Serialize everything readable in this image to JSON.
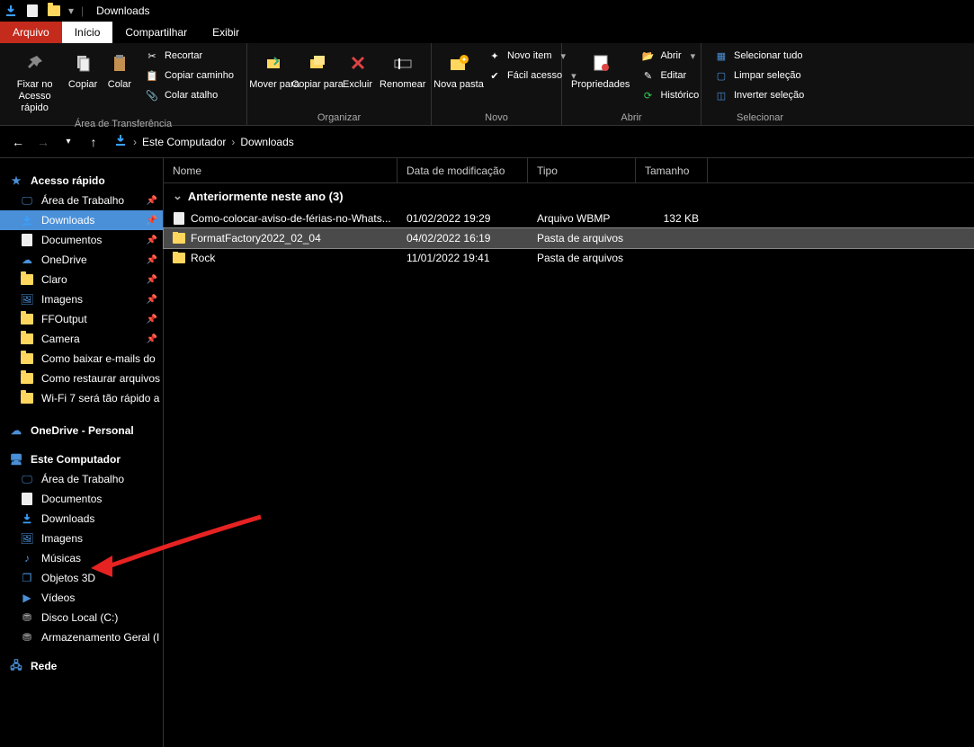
{
  "title_bar": {
    "title": "Downloads"
  },
  "tabs": {
    "arquivo": "Arquivo",
    "inicio": "Início",
    "compartilhar": "Compartilhar",
    "exibir": "Exibir"
  },
  "ribbon": {
    "pin": "Fixar no Acesso rápido",
    "copiar": "Copiar",
    "colar": "Colar",
    "recortar": "Recortar",
    "copiar_caminho": "Copiar caminho",
    "colar_atalho": "Colar atalho",
    "group_area": "Área de Transferência",
    "mover_para": "Mover para",
    "copiar_para": "Copiar para",
    "excluir": "Excluir",
    "renomear": "Renomear",
    "group_organizar": "Organizar",
    "nova_pasta": "Nova pasta",
    "novo_item": "Novo item",
    "facil_acesso": "Fácil acesso",
    "group_novo": "Novo",
    "propriedades": "Propriedades",
    "abrir": "Abrir",
    "editar": "Editar",
    "historico": "Histórico",
    "group_abrir": "Abrir",
    "sel_tudo": "Selecionar tudo",
    "limpar_sel": "Limpar seleção",
    "inv_sel": "Inverter seleção",
    "group_selecionar": "Selecionar"
  },
  "breadcrumb": {
    "root": "Este Computador",
    "current": "Downloads"
  },
  "columns": {
    "nome": "Nome",
    "data": "Data de modificação",
    "tipo": "Tipo",
    "tamanho": "Tamanho"
  },
  "sidebar": {
    "quick_access": "Acesso rápido",
    "quick_items": [
      {
        "label": "Área de Trabalho",
        "icon": "desktop"
      },
      {
        "label": "Downloads",
        "icon": "download",
        "active": true
      },
      {
        "label": "Documentos",
        "icon": "document"
      },
      {
        "label": "OneDrive",
        "icon": "cloud"
      },
      {
        "label": "Claro",
        "icon": "folder"
      },
      {
        "label": "Imagens",
        "icon": "image"
      },
      {
        "label": "FFOutput",
        "icon": "folder"
      },
      {
        "label": "Camera",
        "icon": "folder"
      },
      {
        "label": "Como baixar e-mails do",
        "icon": "folder"
      },
      {
        "label": "Como restaurar arquivos",
        "icon": "folder"
      },
      {
        "label": "Wi-Fi 7 será tão rápido a",
        "icon": "folder"
      }
    ],
    "onedrive": "OneDrive - Personal",
    "this_pc": "Este Computador",
    "this_pc_items": [
      {
        "label": "Área de Trabalho",
        "icon": "desktop"
      },
      {
        "label": "Documentos",
        "icon": "document"
      },
      {
        "label": "Downloads",
        "icon": "download"
      },
      {
        "label": "Imagens",
        "icon": "image"
      },
      {
        "label": "Músicas",
        "icon": "music"
      },
      {
        "label": "Objetos 3D",
        "icon": "cube"
      },
      {
        "label": "Vídeos",
        "icon": "video"
      },
      {
        "label": "Disco Local (C:)",
        "icon": "disk"
      },
      {
        "label": "Armazenamento Geral (I",
        "icon": "disk"
      }
    ],
    "rede": "Rede"
  },
  "group_header": "Anteriormente neste ano (3)",
  "files": [
    {
      "name": "Como-colocar-aviso-de-férias-no-Whats...",
      "date": "01/02/2022 19:29",
      "type": "Arquivo WBMP",
      "size": "132 KB",
      "icon": "file"
    },
    {
      "name": "FormatFactory2022_02_04",
      "date": "04/02/2022 16:19",
      "type": "Pasta de arquivos",
      "size": "",
      "icon": "folder",
      "selected": true
    },
    {
      "name": "Rock",
      "date": "11/01/2022 19:41",
      "type": "Pasta de arquivos",
      "size": "",
      "icon": "folder"
    }
  ],
  "col_widths": {
    "name": 260,
    "date": 145,
    "type": 120,
    "size": 80
  }
}
